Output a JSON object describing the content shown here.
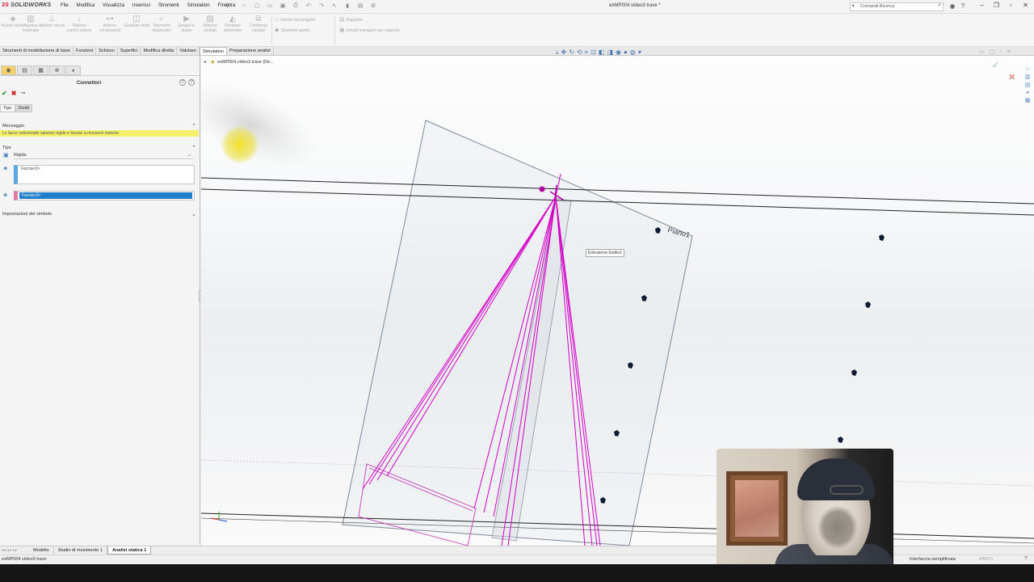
{
  "app": {
    "logo_prefix": "3S",
    "logo_text": "SOLIDWORKS",
    "document_title": "exMP004 video3 trave *",
    "search_placeholder": "Comandi Ricerca"
  },
  "menu": [
    "File",
    "Modifica",
    "Visualizza",
    "Inserisci",
    "Strumenti",
    "Simulation",
    "Finestra"
  ],
  "ribbon": {
    "buttons": [
      {
        "label": "Nuovo studio",
        "icon": "study-icon"
      },
      {
        "label": "Applica materiale",
        "icon": "material-icon"
      },
      {
        "label": "Advisor vincoli",
        "icon": "fixture-icon"
      },
      {
        "label": "Advisor carichi esterni",
        "icon": "load-icon"
      },
      {
        "label": "Advisor connessioni",
        "icon": "connection-icon"
      },
      {
        "label": "Gestione shell",
        "icon": "shell-icon"
      },
      {
        "label": "Strumenti diagnostici",
        "icon": "diagnostic-icon"
      },
      {
        "label": "Esegui lo studio",
        "icon": "run-icon"
      },
      {
        "label": "Advisor risultati",
        "icon": "results-icon"
      },
      {
        "label": "Risultato deformato",
        "icon": "deformed-icon"
      },
      {
        "label": "Confronta risultati",
        "icon": "compare-icon"
      }
    ],
    "small": [
      {
        "label": "Intento del progetto",
        "icon": "design-intent-icon"
      },
      {
        "label": "Strumenti grafici",
        "icon": "plot-tools-icon"
      },
      {
        "label": "Rapporto",
        "icon": "report-icon"
      },
      {
        "label": "Includi immagine per rapporto",
        "icon": "image-report-icon"
      }
    ]
  },
  "command_tabs": [
    "Strumenti di modellazione di base",
    "Funzioni",
    "Schizzo",
    "Superfici",
    "Modifica diretta",
    "Valutare",
    "Simulation",
    "Preparazione analisi"
  ],
  "active_command_tab": "Simulation",
  "property_manager": {
    "title": "Connettori",
    "subtabs": [
      "Tipo",
      "Dividi"
    ],
    "message_header": "Messaggio",
    "message": "Le facce selezionate saranno rigide e forzate a muoversi insieme.",
    "type_header": "Tipo",
    "type_value": "Rigida",
    "face_set_1": "Faccia<2>",
    "face_set_2": "Faccia<3>",
    "symbol_settings": "Impostazioni del simbolo"
  },
  "graphics": {
    "tree_root": "exMP004 video3 trave (De...",
    "plane_label": "Piano1",
    "tooltip": "Estrusione-Sottile1",
    "accent_color": "#d400c8"
  },
  "bottom_tabs": [
    "Modello",
    "Studio di movimento 1",
    "Analisi statica 1"
  ],
  "active_bottom_tab": "Analisi statica 1",
  "status": {
    "left": "exMP004 video3 trave",
    "right": "Interfaccia semplificata",
    "units": "MMGS"
  }
}
